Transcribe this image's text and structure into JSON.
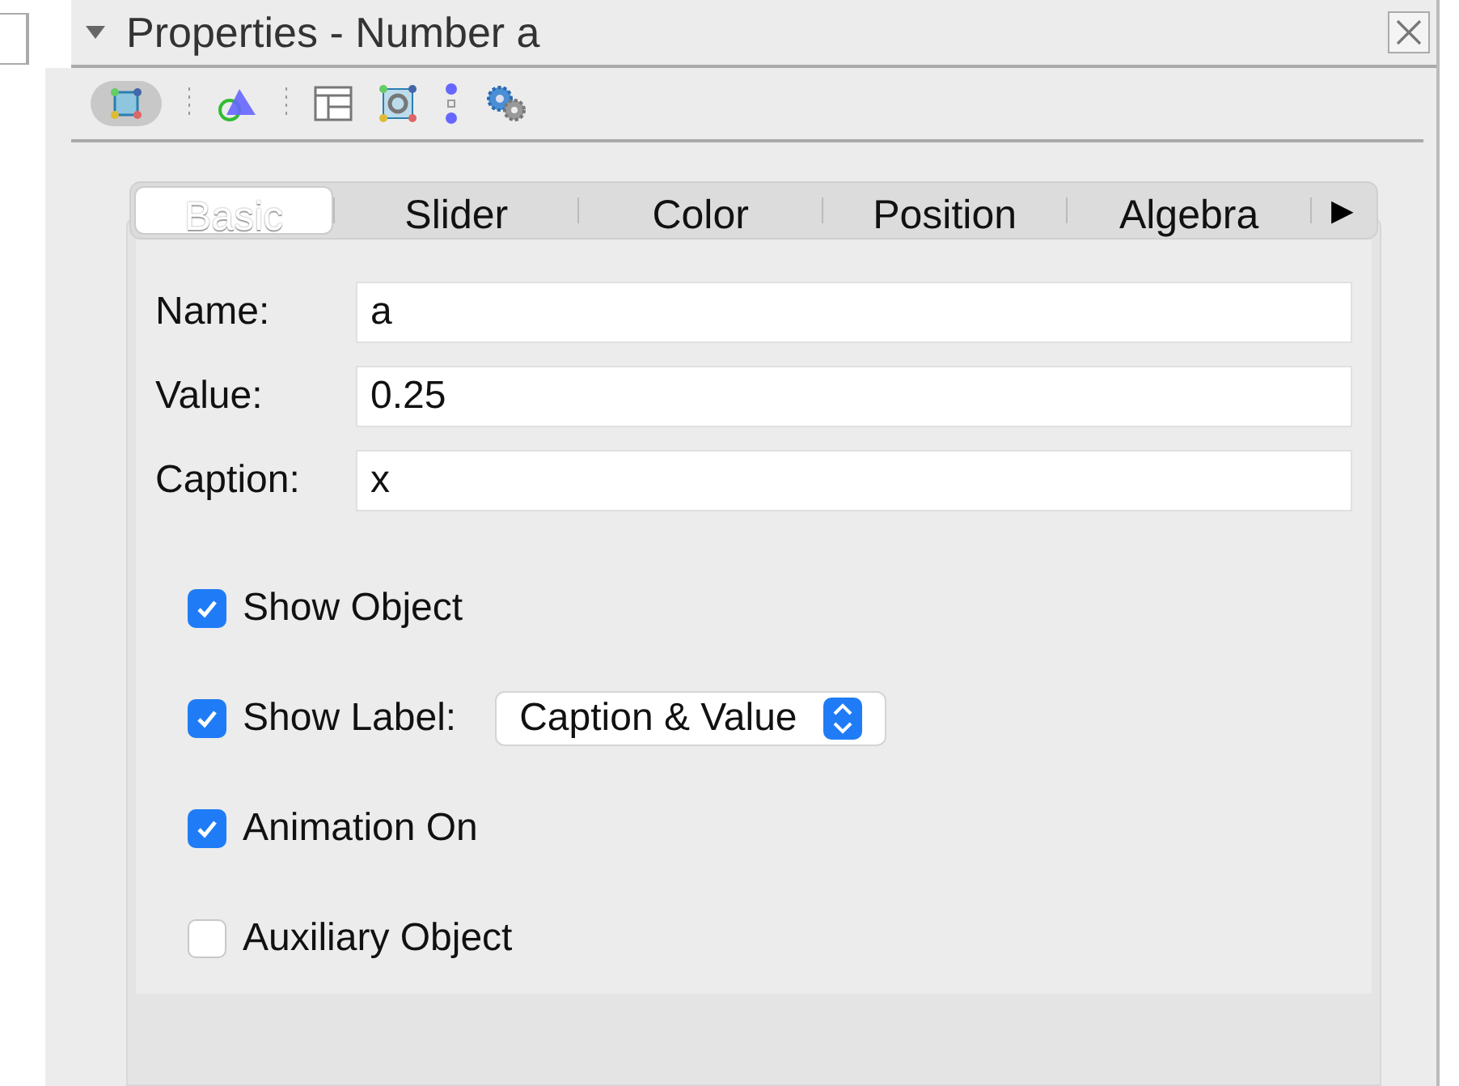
{
  "panel": {
    "title": "Properties - Number a",
    "expanded": true
  },
  "tabs": [
    {
      "label": "Basic",
      "selected": true
    },
    {
      "label": "Slider",
      "selected": false
    },
    {
      "label": "Color",
      "selected": false
    },
    {
      "label": "Position",
      "selected": false
    },
    {
      "label": "Algebra",
      "selected": false
    }
  ],
  "tab_scroll": "▶",
  "fields": [
    {
      "label": "Name:",
      "value": "a"
    },
    {
      "label": "Value:",
      "value": "0.25"
    },
    {
      "label": "Caption:",
      "value": "x"
    }
  ],
  "options": [
    {
      "kind": "checkbox",
      "label": "Show Object",
      "checked": true
    },
    {
      "kind": "checkbox-select",
      "label": "Show Label:",
      "checked": true,
      "value": "Caption & Value"
    },
    {
      "kind": "checkbox",
      "label": "Animation On",
      "checked": true
    },
    {
      "kind": "checkbox",
      "label": "Auxiliary Object",
      "checked": false
    }
  ]
}
